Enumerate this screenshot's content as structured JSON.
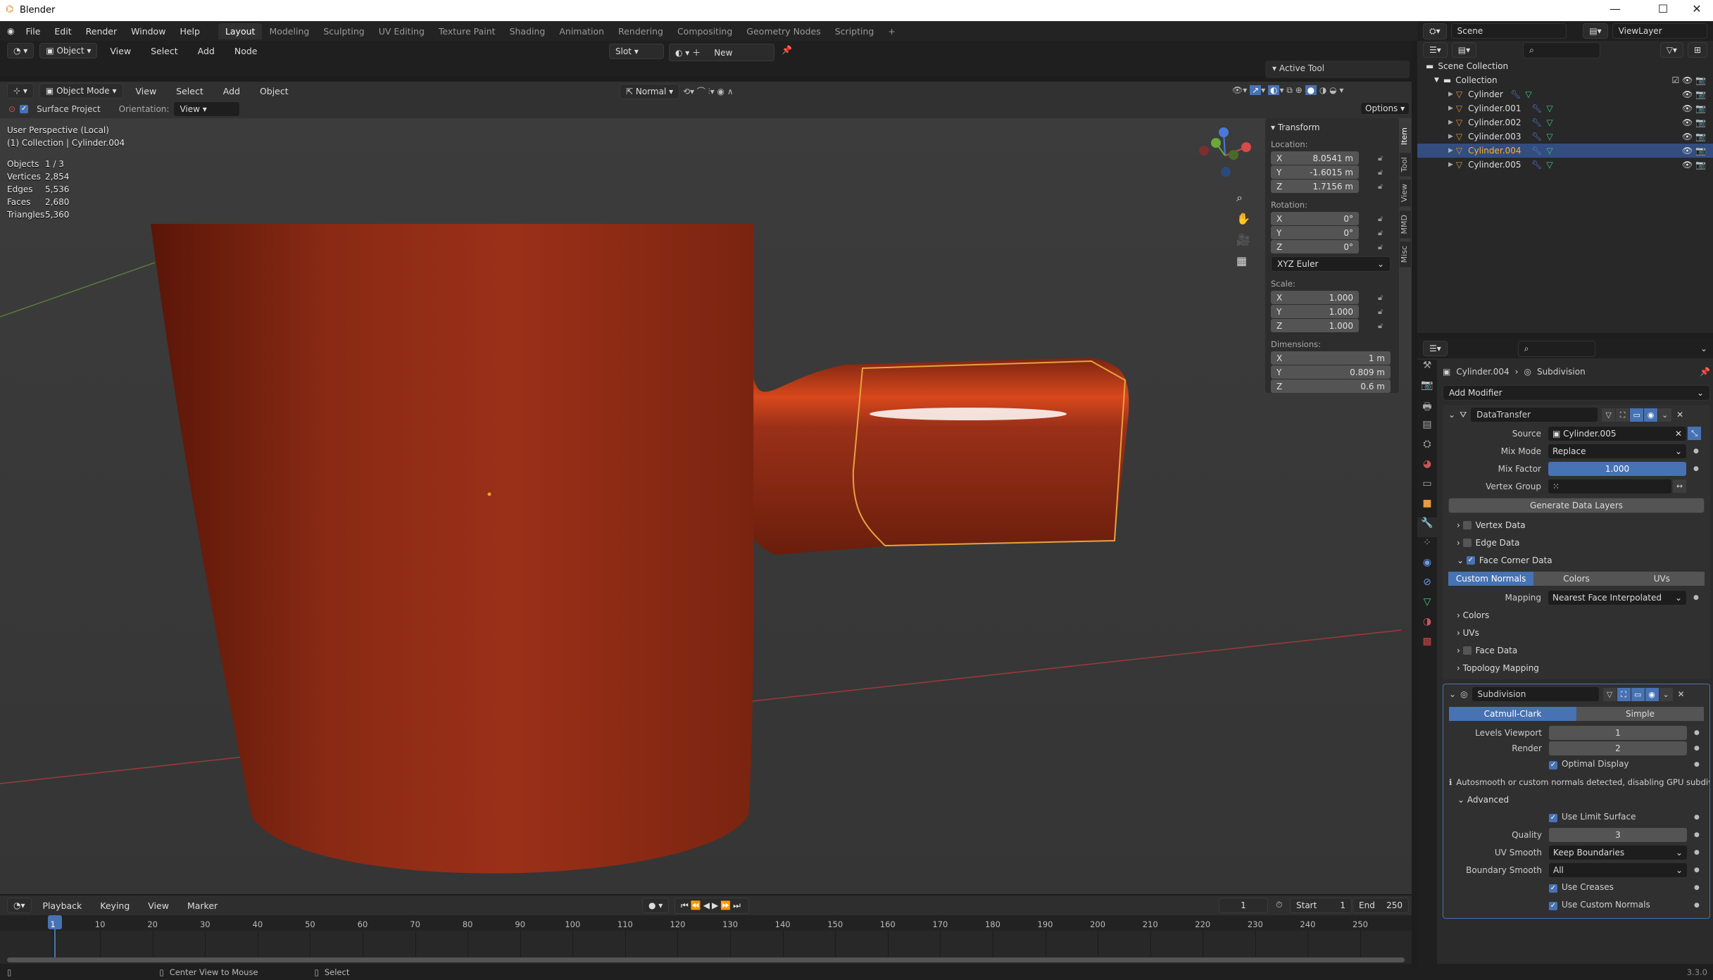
{
  "window": {
    "title": "Blender",
    "minimize": "—",
    "maximize": "☐",
    "close": "✕"
  },
  "menus": [
    "File",
    "Edit",
    "Render",
    "Window",
    "Help"
  ],
  "workspaces": [
    "Layout",
    "Modeling",
    "Sculpting",
    "UV Editing",
    "Texture Paint",
    "Shading",
    "Animation",
    "Rendering",
    "Compositing",
    "Geometry Nodes",
    "Scripting",
    "+"
  ],
  "active_workspace": "Layout",
  "top_header": {
    "mode": "Object",
    "items": [
      "View",
      "Select",
      "Add",
      "Node"
    ],
    "slot": "Slot",
    "new": "New"
  },
  "viewport_header": {
    "mode": "Object Mode",
    "items": [
      "View",
      "Select",
      "Add",
      "Object"
    ],
    "orientation_pivot": "Normal",
    "surface_project": "Surface Project",
    "orientation_label": "Orientation:",
    "orientation_value": "View",
    "options": "Options"
  },
  "viewport": {
    "perspective": "User Perspective (Local)",
    "collection": "(1) Collection | Cylinder.004",
    "stats": [
      {
        "k": "Objects",
        "v": "1 / 3"
      },
      {
        "k": "Vertices",
        "v": "2,854"
      },
      {
        "k": "Edges",
        "v": "5,536"
      },
      {
        "k": "Faces",
        "v": "2,680"
      },
      {
        "k": "Triangles",
        "v": "5,360"
      }
    ],
    "mesh_color": "#8a2a14",
    "selection_color": "#e8a33c"
  },
  "active_tool": "Active Tool",
  "npanel": {
    "title": "Transform",
    "location_label": "Location:",
    "location": [
      {
        "a": "X",
        "v": "8.0541 m"
      },
      {
        "a": "Y",
        "v": "-1.6015 m"
      },
      {
        "a": "Z",
        "v": "1.7156 m"
      }
    ],
    "rotation_label": "Rotation:",
    "rotation": [
      {
        "a": "X",
        "v": "0°"
      },
      {
        "a": "Y",
        "v": "0°"
      },
      {
        "a": "Z",
        "v": "0°"
      }
    ],
    "rotation_mode": "XYZ Euler",
    "scale_label": "Scale:",
    "scale": [
      {
        "a": "X",
        "v": "1.000"
      },
      {
        "a": "Y",
        "v": "1.000"
      },
      {
        "a": "Z",
        "v": "1.000"
      }
    ],
    "dimensions_label": "Dimensions:",
    "dimensions": [
      {
        "a": "X",
        "v": "1 m"
      },
      {
        "a": "Y",
        "v": "0.809 m"
      },
      {
        "a": "Z",
        "v": "0.6 m"
      }
    ],
    "tabs": [
      "Item",
      "Tool",
      "View",
      "MMD",
      "Misc"
    ]
  },
  "outliner": {
    "scene": "Scene",
    "view_layer": "ViewLayer",
    "scene_collection": "Scene Collection",
    "collection": "Collection",
    "objects": [
      "Cylinder",
      "Cylinder.001",
      "Cylinder.002",
      "Cylinder.003",
      "Cylinder.004",
      "Cylinder.005"
    ],
    "selected": "Cylinder.004"
  },
  "properties": {
    "breadcrumb_object": "Cylinder.004",
    "breadcrumb_modifier": "Subdivision",
    "add_modifier": "Add Modifier",
    "datatransfer": {
      "name": "DataTransfer",
      "source_label": "Source",
      "source": "Cylinder.005",
      "mix_mode_label": "Mix Mode",
      "mix_mode": "Replace",
      "mix_factor_label": "Mix Factor",
      "mix_factor": "1.000",
      "vertex_group_label": "Vertex Group",
      "generate": "Generate Data Layers",
      "vertex_data": "Vertex Data",
      "edge_data": "Edge Data",
      "face_corner_data": "Face Corner Data",
      "tabs": [
        "Custom Normals",
        "Colors",
        "UVs"
      ],
      "mapping_label": "Mapping",
      "mapping": "Nearest Face Interpolated",
      "colors": "Colors",
      "uvs": "UVs",
      "face_data": "Face Data",
      "topology": "Topology Mapping"
    },
    "subdivision": {
      "name": "Subdivision",
      "types": [
        "Catmull-Clark",
        "Simple"
      ],
      "levels_label": "Levels Viewport",
      "levels": "1",
      "render_label": "Render",
      "render": "2",
      "optimal": "Optimal Display",
      "info": "Autosmooth or custom normals detected, disabling GPU subdivisio",
      "advanced": "Advanced",
      "limit": "Use Limit Surface",
      "quality_label": "Quality",
      "quality": "3",
      "uv_smooth_label": "UV Smooth",
      "uv_smooth": "Keep Boundaries",
      "boundary_label": "Boundary Smooth",
      "boundary": "All",
      "creases": "Use Creases",
      "custom_normals": "Use Custom Normals"
    }
  },
  "timeline": {
    "menus": [
      "Playback",
      "Keying",
      "View",
      "Marker"
    ],
    "current_frame": "1",
    "start_label": "Start",
    "start": "1",
    "end_label": "End",
    "end": "250",
    "ticks": [
      "1",
      "10",
      "20",
      "30",
      "40",
      "50",
      "60",
      "70",
      "80",
      "90",
      "100",
      "110",
      "120",
      "130",
      "140",
      "150",
      "160",
      "170",
      "180",
      "190",
      "200",
      "210",
      "220",
      "230",
      "240",
      "250"
    ]
  },
  "status": {
    "center": "Center View to Mouse",
    "select": "Select",
    "version": "3.3.0"
  },
  "accent": "#4772b3"
}
